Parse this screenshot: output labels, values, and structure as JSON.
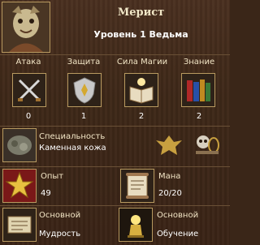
{
  "hero": {
    "name": "Мерист",
    "level_text": "Уровень 1 Ведьма"
  },
  "stats": [
    {
      "label": "Атака",
      "value": "0",
      "icon": "attack-icon"
    },
    {
      "label": "Защита",
      "value": "1",
      "icon": "defense-icon"
    },
    {
      "label": "Сила Магии",
      "value": "2",
      "icon": "spellpower-icon"
    },
    {
      "label": "Знание",
      "value": "2",
      "icon": "knowledge-icon"
    }
  ],
  "specialty": {
    "label": "Специальность",
    "value": "Каменная кожа"
  },
  "experience": {
    "label": "Опыт",
    "value": "49"
  },
  "mana": {
    "label": "Мана",
    "value": "20/20"
  },
  "skills": [
    {
      "level": "Основной",
      "name": "Мудрость",
      "icon": "wisdom-icon"
    },
    {
      "level": "Основной",
      "name": "Обучение",
      "icon": "learning-icon"
    }
  ]
}
